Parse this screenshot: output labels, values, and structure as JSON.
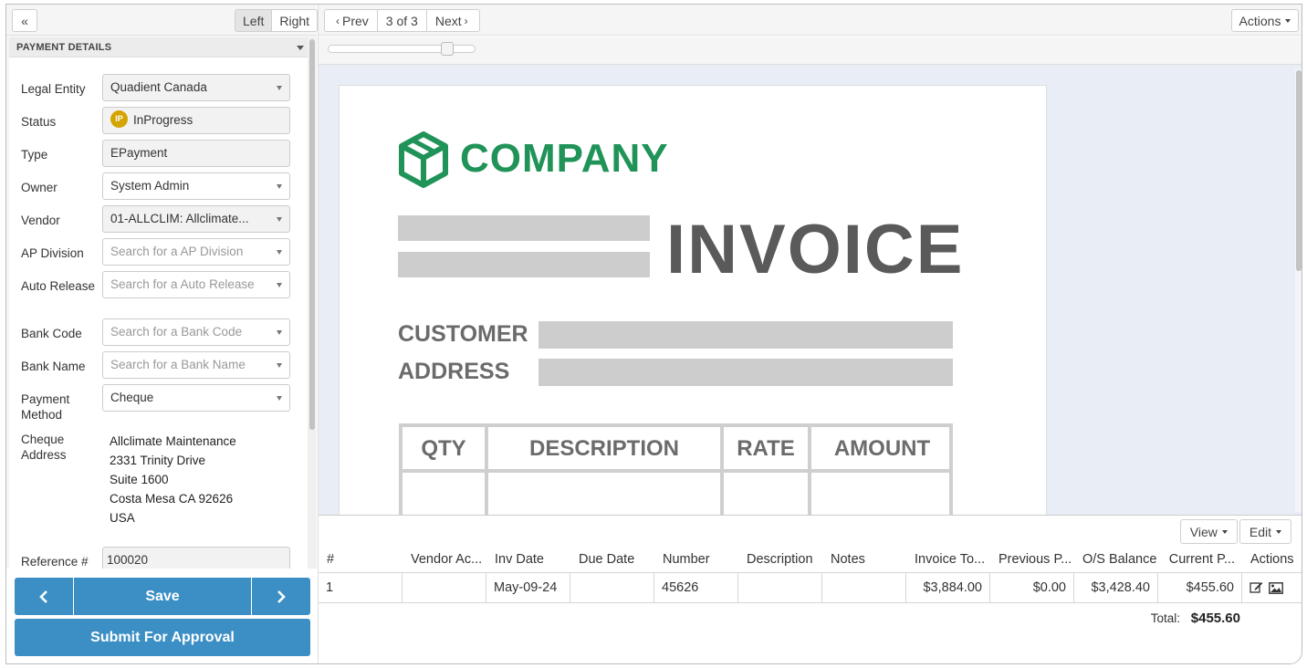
{
  "left_panel": {
    "collapse_label": "«",
    "side_toggle": {
      "left": "Left",
      "right": "Right"
    },
    "section_title": "PAYMENT DETAILS",
    "fields": {
      "legal_entity": {
        "label": "Legal Entity",
        "value": "Quadient Canada"
      },
      "status": {
        "label": "Status",
        "badge": "IP",
        "value": "InProgress"
      },
      "type": {
        "label": "Type",
        "value": "EPayment"
      },
      "owner": {
        "label": "Owner",
        "value": "System Admin"
      },
      "vendor": {
        "label": "Vendor",
        "value": "01-ALLCLIM: Allclimate..."
      },
      "ap_division": {
        "label": "AP Division",
        "placeholder": "Search for a AP Division"
      },
      "auto_release": {
        "label": "Auto Release",
        "placeholder": "Search for a Auto Release"
      },
      "bank_code": {
        "label": "Bank Code",
        "placeholder": "Search for a Bank Code"
      },
      "bank_name": {
        "label": "Bank Name",
        "placeholder": "Search for a Bank Name"
      },
      "payment_method": {
        "label": "Payment Method",
        "value": "Cheque"
      },
      "cheque_address": {
        "label": "Cheque Address",
        "lines": [
          "Allclimate Maintenance",
          "2331 Trinity Drive",
          "Suite 1600",
          "Costa Mesa CA 92626",
          "USA"
        ]
      },
      "reference": {
        "label": "Reference #",
        "value": "100020"
      }
    },
    "buttons": {
      "prev": "‹",
      "save": "Save",
      "next": "›",
      "submit": "Submit For Approval"
    }
  },
  "toolbar": {
    "prev": "Prev",
    "page_indicator": "3 of 3",
    "next": "Next",
    "actions": "Actions"
  },
  "zoom": {
    "level": 0.84
  },
  "document": {
    "company": "COMPANY",
    "title": "INVOICE",
    "customer_label": "CUSTOMER",
    "address_label": "ADDRESS",
    "table_headers": [
      "QTY",
      "DESCRIPTION",
      "RATE",
      "AMOUNT"
    ]
  },
  "grid": {
    "view_button": "View",
    "edit_button": "Edit",
    "headers": [
      "#",
      "Vendor Ac...",
      "Inv Date",
      "Due Date",
      "Number",
      "Description",
      "Notes",
      "Invoice To...",
      "Previous P...",
      "O/S Balance",
      "Current P...",
      "Actions"
    ],
    "rows": [
      {
        "index": "1",
        "vendor_account": "",
        "inv_date": "May-09-24",
        "due_date": "",
        "number": "45626",
        "description": "",
        "notes": "",
        "invoice_total": "$3,884.00",
        "previous_paid": "$0.00",
        "os_balance": "$3,428.40",
        "current_payment": "$455.60"
      }
    ],
    "total_label": "Total:",
    "total_value": "$455.60"
  },
  "colors": {
    "primary_button": "#3b8fc5",
    "company_green": "#1f9358",
    "status_badge": "#d4a400"
  }
}
